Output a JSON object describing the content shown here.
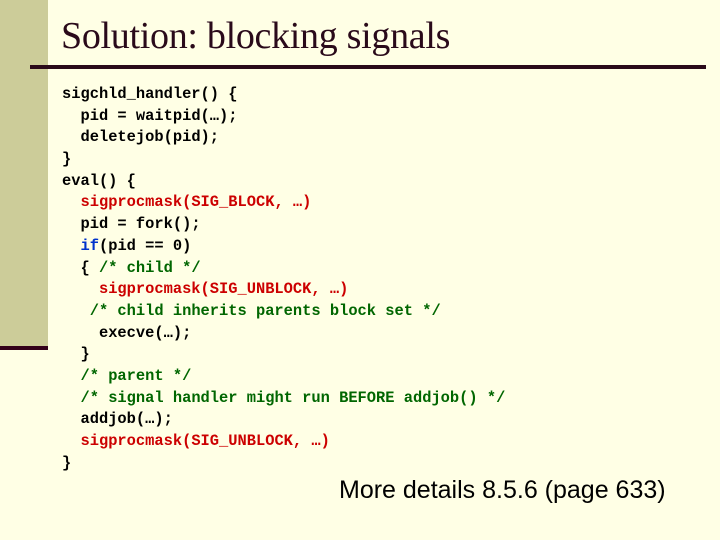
{
  "slide": {
    "title": "Solution: blocking signals",
    "footer": "More details 8.5.6 (page 633)",
    "colors": {
      "background": "#ffffe5",
      "sidebar": "#cccc99",
      "accent_dark": "#2a0a1a",
      "code_function_highlight": "#cc0000",
      "code_keyword": "#0033cc",
      "code_comment": "#006600",
      "code_text": "#000000"
    },
    "code_lines": [
      {
        "indent": "",
        "tokens": [
          {
            "text": "sigchld_handler() {",
            "style": "black"
          }
        ]
      },
      {
        "indent": "  ",
        "tokens": [
          {
            "text": "pid = waitpid(…);",
            "style": "black"
          }
        ]
      },
      {
        "indent": "  ",
        "tokens": [
          {
            "text": "deletejob(pid);",
            "style": "black"
          }
        ]
      },
      {
        "indent": "",
        "tokens": [
          {
            "text": "}",
            "style": "black"
          }
        ]
      },
      {
        "indent": "",
        "tokens": [
          {
            "text": "eval() {",
            "style": "black"
          }
        ]
      },
      {
        "indent": "  ",
        "tokens": [
          {
            "text": "sigprocmask(SIG_BLOCK, …)",
            "style": "red"
          }
        ]
      },
      {
        "indent": "  ",
        "tokens": [
          {
            "text": "pid = fork();",
            "style": "black"
          }
        ]
      },
      {
        "indent": "  ",
        "tokens": [
          {
            "text": "if",
            "style": "blue"
          },
          {
            "text": "(pid == 0)",
            "style": "black"
          }
        ]
      },
      {
        "indent": "  ",
        "tokens": [
          {
            "text": "{ ",
            "style": "black"
          },
          {
            "text": "/* child */",
            "style": "green"
          }
        ]
      },
      {
        "indent": "    ",
        "tokens": [
          {
            "text": "sigprocmask(SIG_UNBLOCK, …)",
            "style": "red"
          }
        ]
      },
      {
        "indent": "   ",
        "tokens": [
          {
            "text": "/* child inherits parents block set */",
            "style": "green"
          }
        ]
      },
      {
        "indent": "    ",
        "tokens": [
          {
            "text": "execve(…);",
            "style": "black"
          }
        ]
      },
      {
        "indent": "  ",
        "tokens": [
          {
            "text": "}",
            "style": "black"
          }
        ]
      },
      {
        "indent": "  ",
        "tokens": [
          {
            "text": "/* parent */",
            "style": "green"
          }
        ]
      },
      {
        "indent": "  ",
        "tokens": [
          {
            "text": "/* signal handler might run BEFORE addjob() */",
            "style": "green"
          }
        ]
      },
      {
        "indent": "  ",
        "tokens": [
          {
            "text": "addjob(…);",
            "style": "black"
          }
        ]
      },
      {
        "indent": "  ",
        "tokens": [
          {
            "text": "sigprocmask(SIG_UNBLOCK, …)",
            "style": "red"
          }
        ]
      },
      {
        "indent": "",
        "tokens": [
          {
            "text": "}",
            "style": "black"
          }
        ]
      }
    ]
  }
}
